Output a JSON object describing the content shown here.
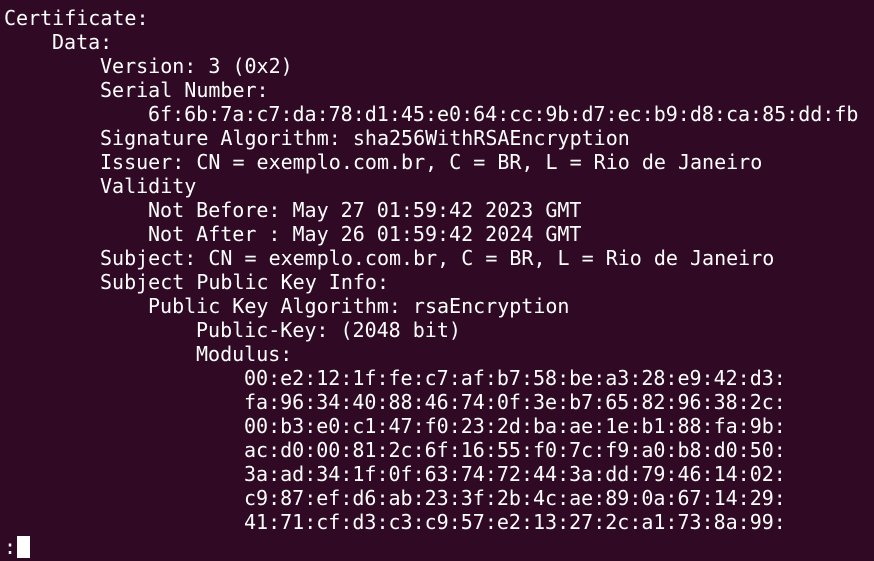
{
  "terminal": {
    "background": "#300a24",
    "foreground": "#ffffff",
    "lines": [
      {
        "indent": 0,
        "text": "Certificate:"
      },
      {
        "indent": 1,
        "text": "Data:"
      },
      {
        "indent": 2,
        "text": "Version: 3 (0x2)"
      },
      {
        "indent": 2,
        "text": "Serial Number:"
      },
      {
        "indent": 3,
        "text": "6f:6b:7a:c7:da:78:d1:45:e0:64:cc:9b:d7:ec:b9:d8:ca:85:dd:fb"
      },
      {
        "indent": 2,
        "text": "Signature Algorithm: sha256WithRSAEncryption"
      },
      {
        "indent": 2,
        "text": "Issuer: CN = exemplo.com.br, C = BR, L = Rio de Janeiro"
      },
      {
        "indent": 2,
        "text": "Validity"
      },
      {
        "indent": 3,
        "text": "Not Before: May 27 01:59:42 2023 GMT"
      },
      {
        "indent": 3,
        "text": "Not After : May 26 01:59:42 2024 GMT"
      },
      {
        "indent": 2,
        "text": "Subject: CN = exemplo.com.br, C = BR, L = Rio de Janeiro"
      },
      {
        "indent": 2,
        "text": "Subject Public Key Info:"
      },
      {
        "indent": 3,
        "text": "Public Key Algorithm: rsaEncryption"
      },
      {
        "indent": 4,
        "text": "Public-Key: (2048 bit)"
      },
      {
        "indent": 4,
        "text": "Modulus:"
      },
      {
        "indent": 5,
        "text": "00:e2:12:1f:fe:c7:af:b7:58:be:a3:28:e9:42:d3:"
      },
      {
        "indent": 5,
        "text": "fa:96:34:40:88:46:74:0f:3e:b7:65:82:96:38:2c:"
      },
      {
        "indent": 5,
        "text": "00:b3:e0:c1:47:f0:23:2d:ba:ae:1e:b1:88:fa:9b:"
      },
      {
        "indent": 5,
        "text": "ac:d0:00:81:2c:6f:16:55:f0:7c:f9:a0:b8:d0:50:"
      },
      {
        "indent": 5,
        "text": "3a:ad:34:1f:0f:63:74:72:44:3a:dd:79:46:14:02:"
      },
      {
        "indent": 5,
        "text": "c9:87:ef:d6:ab:23:3f:2b:4c:ae:89:0a:67:14:29:"
      },
      {
        "indent": 5,
        "text": "41:71:cf:d3:c3:c9:57:e2:13:27:2c:a1:73:8a:99:"
      }
    ],
    "prompt": ":"
  }
}
